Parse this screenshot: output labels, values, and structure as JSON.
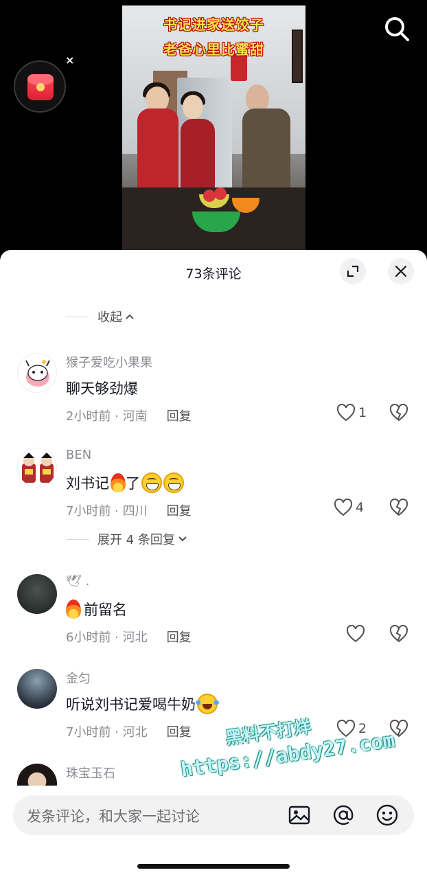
{
  "video": {
    "caption_line1": "书记进家送饺子",
    "caption_line2": "老爸心里比蜜甜"
  },
  "red_packet": {
    "close_label": "×"
  },
  "sheet": {
    "title": "73条评论",
    "collapse_label": "收起",
    "expand_replies_label": "展开 4 条回复"
  },
  "comments": [
    {
      "nick": "猴子爱吃小果果",
      "text": "聊天够劲爆",
      "time": "2小时前 · 河南",
      "reply": "回复",
      "likes": "1"
    },
    {
      "nick": "BEN",
      "text": "刘书记",
      "text_suffix": "了",
      "time": "7小时前 · 四川",
      "reply": "回复",
      "likes": "4"
    },
    {
      "nick": "🕊 .",
      "text": "前留名",
      "time": "6小时前 · 河北",
      "reply": "回复",
      "likes": ""
    },
    {
      "nick": "金匀",
      "text": "听说刘书记爱喝牛奶",
      "time": "7小时前 · 河北",
      "reply": "回复",
      "likes": "2"
    },
    {
      "nick": "珠宝玉石"
    }
  ],
  "input": {
    "placeholder": "发条评论，和大家一起讨论"
  },
  "watermark": {
    "line1": "黑料不打烊",
    "line2": "https://abdy27.com"
  },
  "colors": {
    "like_icon": "#505050",
    "meta": "#8a8b91",
    "text": "#161823"
  }
}
